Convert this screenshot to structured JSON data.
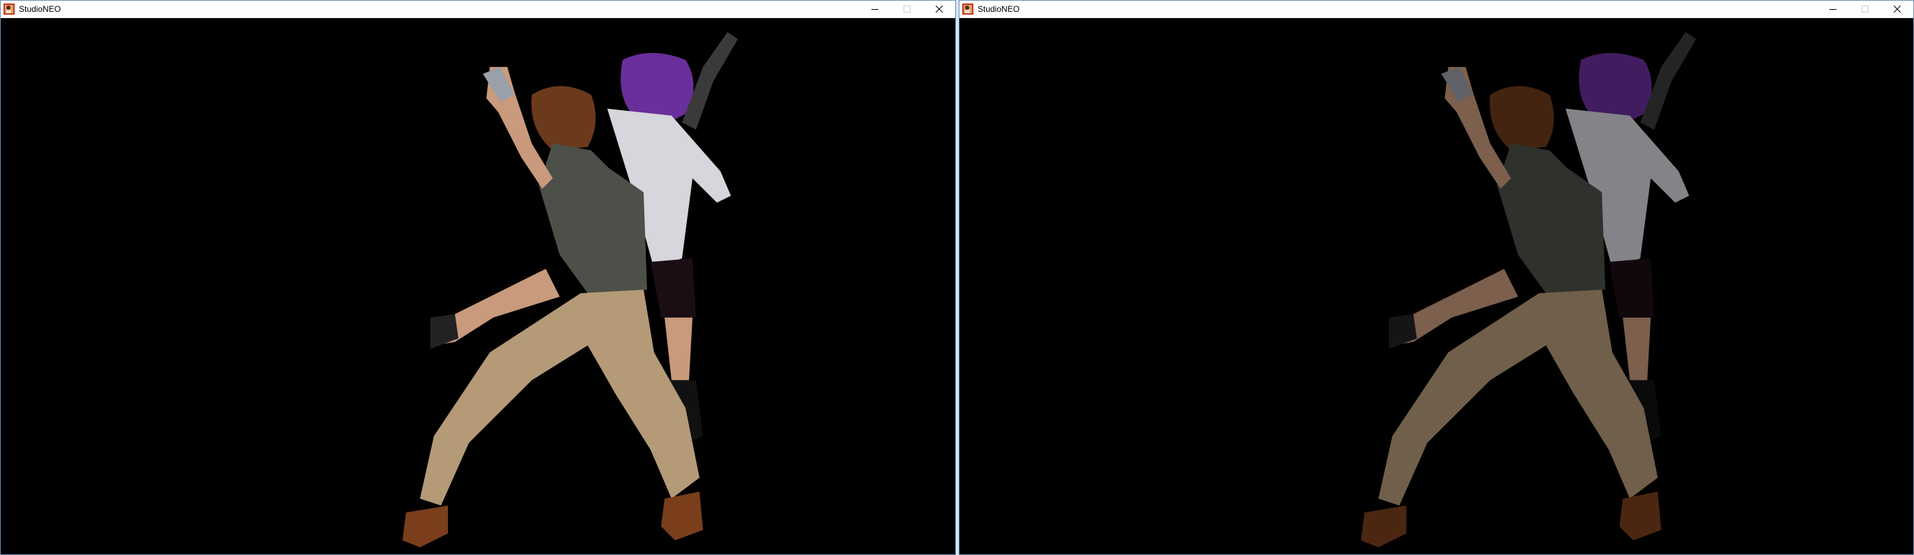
{
  "windows": [
    {
      "title": "StudioNEO",
      "icon": "studioneo-app-icon",
      "variant": "bright",
      "caption_buttons": [
        "minimize-icon",
        "maximize-icon",
        "close-icon"
      ],
      "maximize_enabled": false
    },
    {
      "title": "StudioNEO",
      "icon": "studioneo-app-icon",
      "variant": "dim",
      "caption_buttons": [
        "minimize-icon",
        "maximize-icon",
        "close-icon"
      ],
      "maximize_enabled": false
    }
  ],
  "colors": {
    "viewport_bg": "#000000",
    "frame_border": "#6d8fb8",
    "hair_girl": "#6a2f9a",
    "hair_boy": "#6b3a1c",
    "shirt_boy": "#4c5048",
    "pants_boy": "#b59a78",
    "jacket_girl": "#d6d6dc",
    "shoes_boy": "#7a3e1c"
  }
}
